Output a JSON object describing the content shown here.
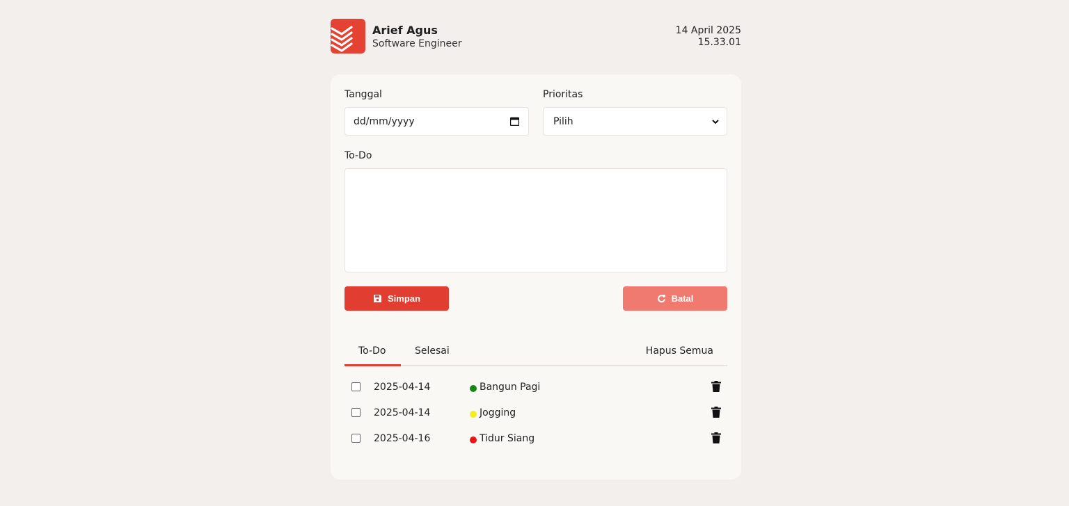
{
  "profile": {
    "name": "Arief Agus",
    "role": "Software Engineer",
    "date": "14 April 2025",
    "time": "15.33.01",
    "logo_icon": "layers-logo-icon"
  },
  "form": {
    "date_label": "Tanggal",
    "date_placeholder": "dd/mm/yyyy",
    "priority_label": "Prioritas",
    "priority_selected": "Pilih",
    "todo_label": "To-Do",
    "todo_value": "",
    "save_label": "Simpan",
    "cancel_label": "Batal"
  },
  "tabs": {
    "todo": "To-Do",
    "done": "Selesai",
    "clear_all": "Hapus Semua",
    "active": "todo"
  },
  "items": [
    {
      "date": "2025-04-14",
      "text": "Bangun Pagi",
      "priority_color": "#138613",
      "checked": false
    },
    {
      "date": "2025-04-14",
      "text": "Jogging",
      "priority_color": "#f3ef1f",
      "checked": false
    },
    {
      "date": "2025-04-16",
      "text": "Tidur Siang",
      "priority_color": "#e81515",
      "checked": false
    }
  ],
  "colors": {
    "accent": "#e23d31",
    "accent_light": "#f07a6f",
    "background": "#f2efec",
    "card": "#faf8f5"
  }
}
